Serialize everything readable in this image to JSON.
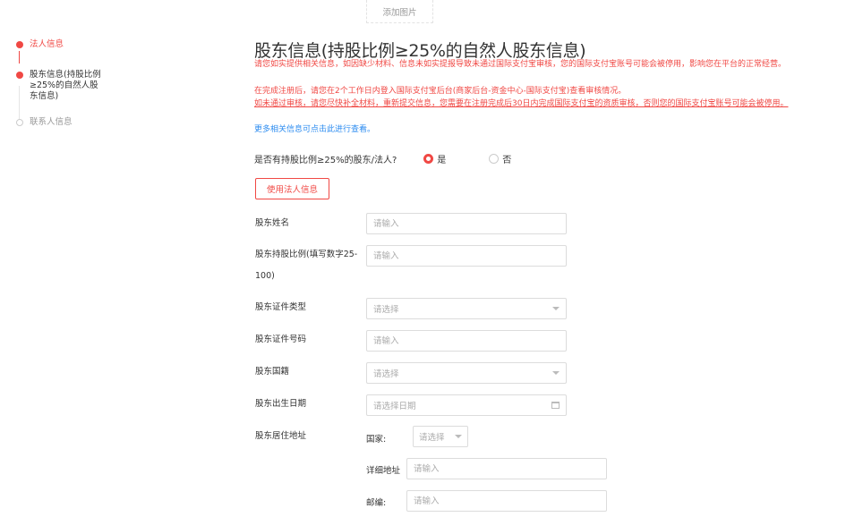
{
  "upload": {
    "label": "添加图片"
  },
  "steps": [
    {
      "label": "法人信息",
      "state": "done"
    },
    {
      "label": "股东信息(持股比例≥25%的自然人股东信息)",
      "state": "active"
    },
    {
      "label": "联系人信息",
      "state": "pending"
    }
  ],
  "main": {
    "title": "股东信息(持股比例≥25%的自然人股东信息)",
    "notice1": "请您如实提供相关信息，如因缺少材料、信息未如实提报导致未通过国际支付宝审核，您的国际支付宝账号可能会被停用，影响您在平台的正常经营。",
    "notice2": "在完成注册后，请您在2个工作日内登入国际支付宝后台(商家后台-资金中心-国际支付宝)查看审核情况。",
    "notice3": "如未通过审核，请您尽快补全材料，重新提交信息，您需要在注册完成后30日内完成国际支付宝的资质审核，否则您的国际支付宝账号可能会被停用。",
    "more_link": "更多相关信息可点击此进行查看。",
    "question": "是否有持股比例≥25%的股东/法人?",
    "yes": "是",
    "no": "否",
    "use_legal_btn": "使用法人信息"
  },
  "form": {
    "name_label": "股东姓名",
    "name_placeholder": "请输入",
    "ratio_label_1": "股东持股比例(填写数字25-",
    "ratio_label_2": "100)",
    "ratio_placeholder": "请输入",
    "id_type_label": "股东证件类型",
    "id_type_placeholder": "请选择",
    "id_no_label": "股东证件号码",
    "id_no_placeholder": "请输入",
    "nationality_label": "股东国籍",
    "nationality_placeholder": "请选择",
    "birth_label": "股东出生日期",
    "birth_placeholder": "请选择日期",
    "address_label": "股东居住地址",
    "country_label": "国家:",
    "country_placeholder": "请选择",
    "detail_label": "详细地址",
    "detail_placeholder": "请输入",
    "zip_label": "邮编:",
    "zip_placeholder": "请输入"
  },
  "colors": {
    "accent": "#f04844",
    "link": "#2d8cf0"
  }
}
